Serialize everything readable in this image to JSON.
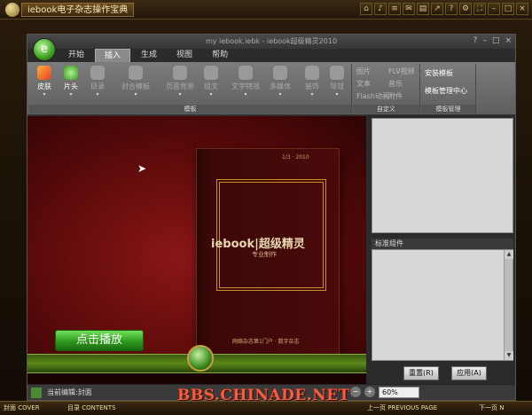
{
  "reader": {
    "title": "iebook电子杂志操作宝典",
    "nav": {
      "cover": "封面 COVER",
      "contents": "目录 CONTENTS",
      "prev": "上一页 PREVIOUS PAGE",
      "next": "下一页 N"
    },
    "watermark": "BBS.CHINADE.NET"
  },
  "app": {
    "title": "my iebook.iebk - iebook超级精灵2010",
    "office_button_glyph": "e",
    "tabs": [
      "开始",
      "插入",
      "生成",
      "视图",
      "帮助"
    ],
    "active_tab": "插入",
    "ribbon": {
      "buttons": [
        "皮肤",
        "片头",
        "目录",
        "封合模板",
        "页面背景",
        "组文",
        "文字特效",
        "多媒体",
        "装饰",
        "导效"
      ],
      "small_items": [
        "图片",
        "FLV视频",
        "文本",
        "音乐",
        "Flash动画",
        "附件"
      ],
      "template_items": [
        "安装模板",
        "模板管理中心"
      ],
      "group_labels": [
        "模板",
        "自定义",
        "模板管理"
      ]
    },
    "canvas": {
      "book_header": "1/3 · 2010",
      "book_brand": "iebook|超级精灵",
      "book_sub": "专业制作",
      "book_footer": "网络杂志第1门户 · 数字杂志",
      "play_button": "点击播放"
    },
    "panel": {
      "label": "标准组件",
      "reset": "重置(R)",
      "apply": "应用(A)"
    },
    "status": {
      "text": "当前编辑:封面",
      "zoom": "60%"
    }
  }
}
